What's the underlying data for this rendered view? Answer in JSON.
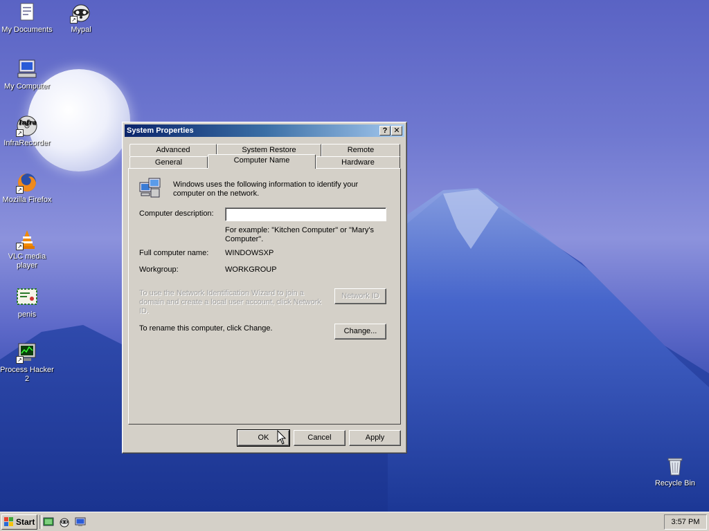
{
  "desktop": {
    "icons": [
      {
        "label": "My Documents",
        "icon": "my-documents-icon"
      },
      {
        "label": "Mypal",
        "icon": "mypal-icon"
      },
      {
        "label": "My Computer",
        "icon": "my-computer-icon"
      },
      {
        "label": "InfraRecorder",
        "icon": "infrarecorder-icon"
      },
      {
        "label": "Mozilla Firefox",
        "icon": "firefox-icon"
      },
      {
        "label": "VLC media player",
        "icon": "vlc-icon"
      },
      {
        "label": "penis",
        "icon": "certificate-file-icon"
      },
      {
        "label": "Process Hacker 2",
        "icon": "process-hacker-icon"
      },
      {
        "label": "Recycle Bin",
        "icon": "recycle-bin-icon"
      }
    ],
    "infrarecorder_logo_text": "Infra"
  },
  "dialog": {
    "title": "System Properties",
    "help_button": "?",
    "close_button": "✕",
    "tabs_back": [
      "Advanced",
      "System Restore",
      "Remote"
    ],
    "tabs_front": [
      "General",
      "Computer Name",
      "Hardware"
    ],
    "active_tab": "Computer Name",
    "intro": "Windows uses the following information to identify your computer on the network.",
    "description_label": "Computer description:",
    "description_value": "",
    "example_text": "For example: \"Kitchen Computer\" or \"Mary's Computer\".",
    "full_name_label": "Full computer name:",
    "full_name_value": "WINDOWSXP",
    "workgroup_label": "Workgroup:",
    "workgroup_value": "WORKGROUP",
    "network_id_text": "To use the Network Identification Wizard to join a domain and create a local user account, click Network ID.",
    "network_id_button": "Network ID",
    "rename_text": "To rename this computer, click Change.",
    "change_button": "Change...",
    "ok_button": "OK",
    "cancel_button": "Cancel",
    "apply_button": "Apply"
  },
  "taskbar": {
    "start_label": "Start",
    "clock": "3:57 PM",
    "quick_launch": [
      "show-desktop-icon",
      "mypal-icon",
      "desktop-icon"
    ]
  }
}
